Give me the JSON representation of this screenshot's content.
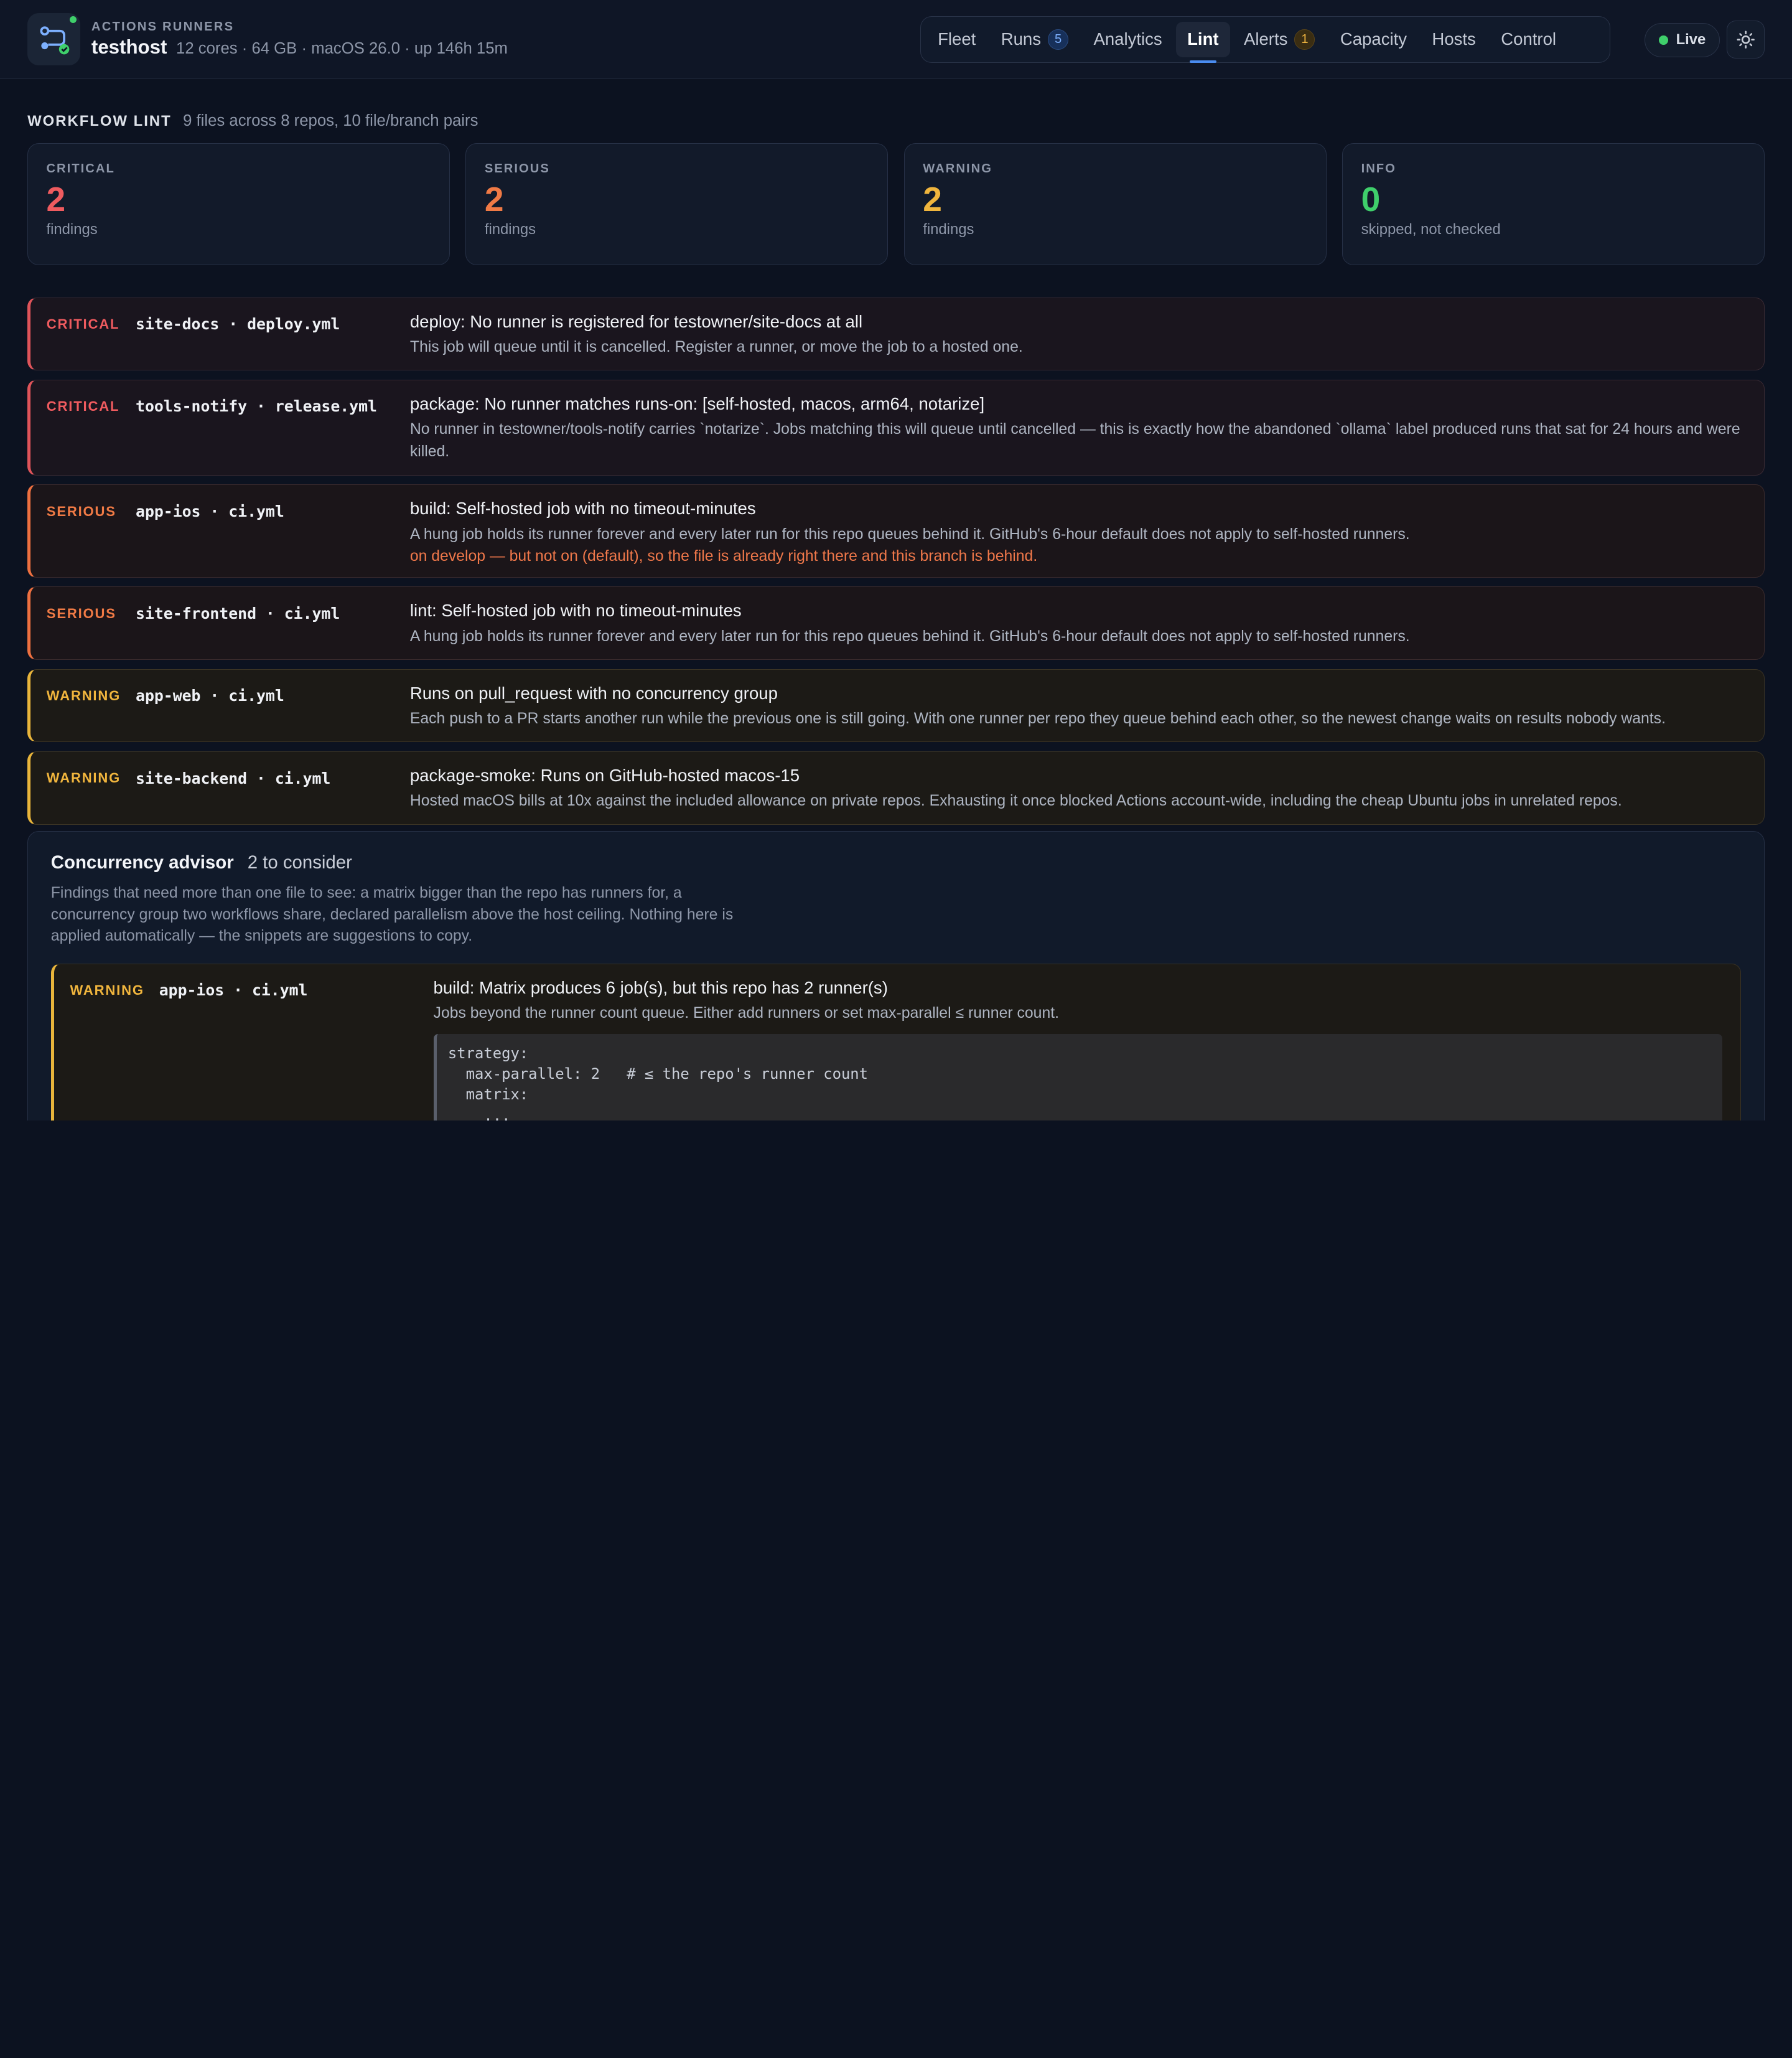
{
  "header": {
    "eyebrow": "ACTIONS RUNNERS",
    "host": "testhost",
    "meta": "12 cores · 64 GB · macOS 26.0 · up 146h 15m",
    "live_label": "Live",
    "nav": [
      {
        "label": "Fleet"
      },
      {
        "label": "Runs",
        "badge": "5"
      },
      {
        "label": "Analytics"
      },
      {
        "label": "Lint",
        "active": true
      },
      {
        "label": "Alerts",
        "badge": "1"
      },
      {
        "label": "Capacity"
      },
      {
        "label": "Hosts"
      },
      {
        "label": "Control"
      }
    ]
  },
  "lint": {
    "title": "WORKFLOW LINT",
    "subtitle": "9 files across 8 repos, 10 file/branch pairs",
    "stats": [
      {
        "label": "CRITICAL",
        "value": "2",
        "caption": "findings",
        "color": "#ef5b5f"
      },
      {
        "label": "SERIOUS",
        "value": "2",
        "caption": "findings",
        "color": "#f07a45"
      },
      {
        "label": "WARNING",
        "value": "2",
        "caption": "findings",
        "color": "#f0b53d"
      },
      {
        "label": "INFO",
        "value": "0",
        "caption": "skipped, not checked",
        "color": "#3fcf6b"
      }
    ],
    "findings": [
      {
        "severity": "CRITICAL",
        "file": "site-docs · deploy.yml",
        "headline": "deploy: No runner is registered for testowner/site-docs at all",
        "detail": "This job will queue until it is cancelled. Register a runner, or move the job to a hosted one."
      },
      {
        "severity": "CRITICAL",
        "file": "tools-notify · release.yml",
        "headline": "package: No runner matches runs-on: [self-hosted, macos, arm64, notarize]",
        "detail": "No runner in testowner/tools-notify carries `notarize`. Jobs matching this will queue until cancelled — this is exactly how the abandoned `ollama` label produced runs that sat for 24 hours and were killed."
      },
      {
        "severity": "SERIOUS",
        "file": "app-ios · ci.yml",
        "headline": "build: Self-hosted job with no timeout-minutes",
        "detail": "A hung job holds its runner forever and every later run for this repo queues behind it. GitHub's 6-hour default does not apply to self-hosted runners.",
        "note": "on develop — but not on (default), so the file is already right there and this branch is behind."
      },
      {
        "severity": "SERIOUS",
        "file": "site-frontend · ci.yml",
        "headline": "lint: Self-hosted job with no timeout-minutes",
        "detail": "A hung job holds its runner forever and every later run for this repo queues behind it. GitHub's 6-hour default does not apply to self-hosted runners."
      },
      {
        "severity": "WARNING",
        "file": "app-web · ci.yml",
        "headline": "Runs on pull_request with no concurrency group",
        "detail": "Each push to a PR starts another run while the previous one is still going. With one runner per repo they queue behind each other, so the newest change waits on results nobody wants."
      },
      {
        "severity": "WARNING",
        "file": "site-backend · ci.yml",
        "headline": "package-smoke: Runs on GitHub-hosted macos-15",
        "detail": "Hosted macOS bills at 10x against the included allowance on private repos. Exhausting it once blocked Actions account-wide, including the cheap Ubuntu jobs in unrelated repos."
      }
    ]
  },
  "advisor": {
    "title": "Concurrency advisor",
    "count": "2 to consider",
    "description": "Findings that need more than one file to see: a matrix bigger than the repo has runners for, a concurrency group two workflows share, declared parallelism above the host ceiling. Nothing here is applied automatically — the snippets are suggestions to copy.",
    "finding": {
      "severity": "WARNING",
      "file": "app-ios · ci.yml",
      "headline": "build: Matrix produces 6 job(s), but this repo has 2 runner(s)",
      "detail": "Jobs beyond the runner count queue. Either add runners or set max-parallel ≤ runner count.",
      "code": "strategy:\n  max-parallel: 2   # ≤ the repo's runner count\n  matrix:\n    ..."
    }
  },
  "colors": {
    "critical": "#ef5b5f",
    "serious": "#f07a45",
    "warning": "#f0b53d",
    "info": "#3fcf6b",
    "accent": "#4a8cf0"
  }
}
